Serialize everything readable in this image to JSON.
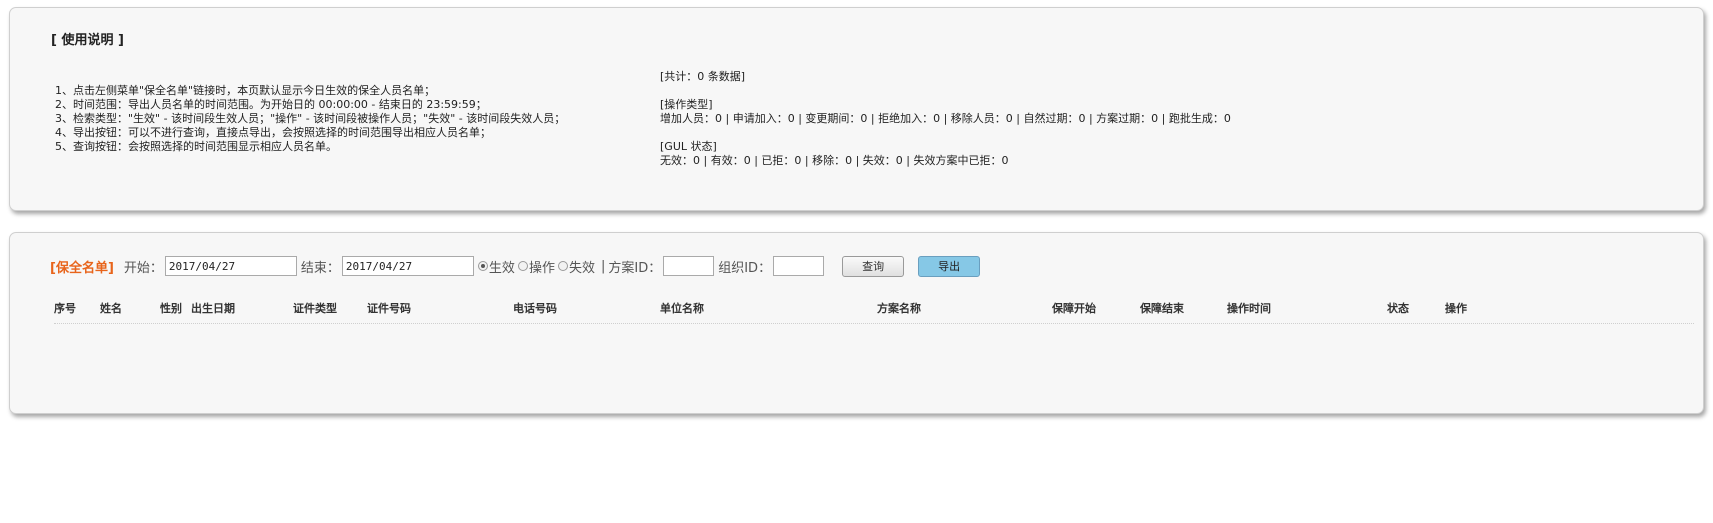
{
  "usage": {
    "title": "[ 使用说明 ]",
    "items": [
      "1、点击左侧菜单\"保全名单\"链接时，本页默认显示今日生效的保全人员名单；",
      "2、时间范围：导出人员名单的时间范围。为开始日的 00:00:00 - 结束日的 23:59:59；",
      "3、检索类型：\"生效\" - 该时间段生效人员；\"操作\" - 该时间段被操作人员；\"失效\" - 该时间段失效人员；",
      "4、导出按钮：可以不进行查询，直接点导出，会按照选择的时间范围导出相应人员名单；",
      "5、查询按钮：会按照选择的时间范围显示相应人员名单。"
    ]
  },
  "stats": {
    "total": "[共计：0 条数据]",
    "op_header": "[操作类型]",
    "op_line": "增加人员：0 | 申请加入：0 | 变更期间：0 | 拒绝加入：0 | 移除人员：0 | 自然过期：0 | 方案过期：0 | 跑批生成：0",
    "gul_header": "[GUL 状态]",
    "gul_line": "无效：0 | 有效：0 | 已拒：0 | 移除：0 | 失效：0 | 失效方案中已拒：0"
  },
  "toolbar": {
    "title": "[保全名单]",
    "start_label": "开始：",
    "start_value": "2017/04/27",
    "end_label": "结束：",
    "end_value": "2017/04/27",
    "radio_effective": "生效",
    "radio_operate": "操作",
    "radio_invalid": "失效",
    "separator": "|",
    "plan_id_label": "方案ID：",
    "org_id_label": "组织ID：",
    "query_label": "查询",
    "export_label": "导出"
  },
  "table": {
    "headers": [
      "序号",
      "姓名",
      "性别",
      "出生日期",
      "证件类型",
      "证件号码",
      "电话号码",
      "单位名称",
      "方案名称",
      "保障开始",
      "保障结束",
      "操作时间",
      "状态",
      "操作"
    ]
  }
}
